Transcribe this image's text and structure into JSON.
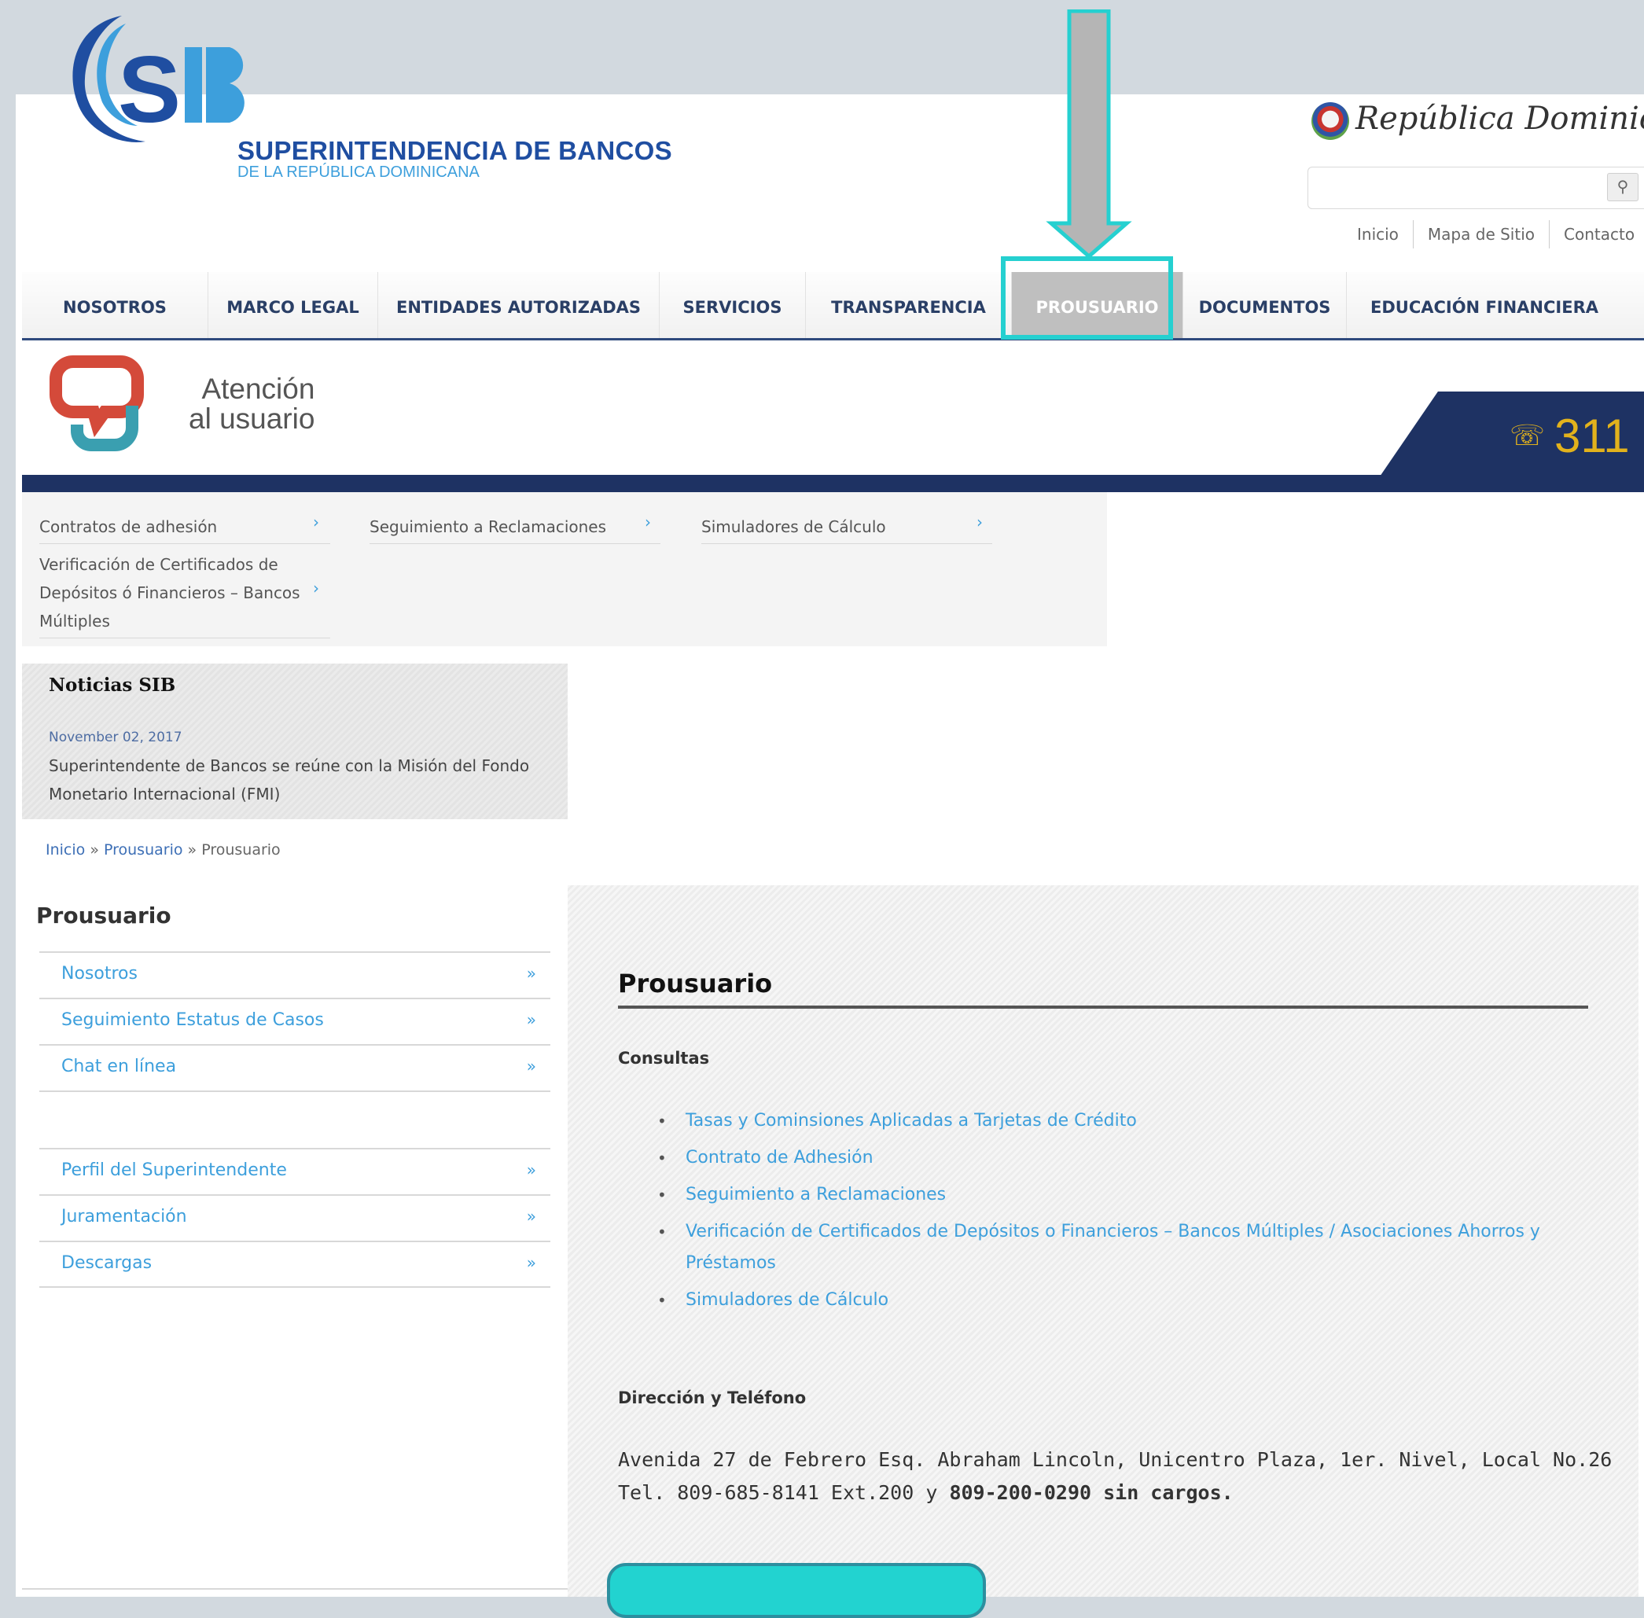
{
  "header": {
    "brand_name": "SUPERINTENDENCIA DE BANCOS",
    "brand_sub": "DE LA REPÚBLICA DOMINICANA",
    "republic_text": "República Dominicana",
    "utility_links": [
      "Inicio",
      "Mapa de Sitio",
      "Contacto"
    ]
  },
  "nav": {
    "items": [
      "NOSOTROS",
      "MARCO LEGAL",
      "ENTIDADES AUTORIZADAS",
      "SERVICIOS",
      "TRANSPARENCIA",
      "PROUSUARIO",
      "DOCUMENTOS",
      "EDUCACIÓN FINANCIERA"
    ],
    "active": "PROUSUARIO"
  },
  "banner": {
    "line1": "Atención",
    "line2": "al usuario",
    "phone": "311"
  },
  "subnav": {
    "item_contratos": "Contratos de adhesión",
    "item_seguimiento": "Seguimiento a Reclamaciones",
    "item_simuladores": "Simuladores de Cálculo",
    "item_verificacion": "Verificación de Certificados de Depósitos ó Financieros – Bancos Múltiples"
  },
  "news": {
    "title": "Noticias SIB",
    "date": "November 02, 2017",
    "headline": "Superintendente de Bancos se reúne con la Misión del Fondo Monetario Internacional (FMI)"
  },
  "breadcrumb": {
    "home": "Inicio",
    "sep": " » ",
    "section": "Prousuario",
    "current": "Prousuario"
  },
  "sidebar": {
    "title": "Prousuario",
    "item_nosotros": "Nosotros",
    "item_seguimiento": "Seguimiento Estatus de Casos",
    "item_chat": "Chat en línea",
    "item_perfil": "Perfil del Superintendente",
    "item_juramentacion": "Juramentación",
    "item_descargas": "Descargas",
    "arrow": "»"
  },
  "content": {
    "title": "Prousuario",
    "consultas_heading": "Consultas",
    "link_tasas": "Tasas y Cominsiones Aplicadas a Tarjetas de Crédito",
    "link_contrato": "Contrato de Adhesión",
    "link_seguimiento": "Seguimiento a Reclamaciones",
    "link_verificacion": "Verificación de Certificados de Depósitos o Financieros – Bancos Múltiples / Asociaciones Ahorros y Préstamos",
    "link_simuladores": "Simuladores de Cálculo",
    "direccion_heading": "Dirección y Teléfono",
    "address": "Avenida 27 de Febrero Esq. Abraham Lincoln, Unicentro Plaza, 1er. Nivel, Local No.26",
    "tel_prefix": "Tel. 809-685-8141 Ext.200 y ",
    "tel_bold": "809-200-0290 sin cargos."
  },
  "colors": {
    "highlight": "#25d0d0",
    "nav_text": "#2a3f66",
    "link": "#3d9fdc",
    "banner_navy": "#1e3263",
    "phone_yellow": "#e2b21c"
  }
}
